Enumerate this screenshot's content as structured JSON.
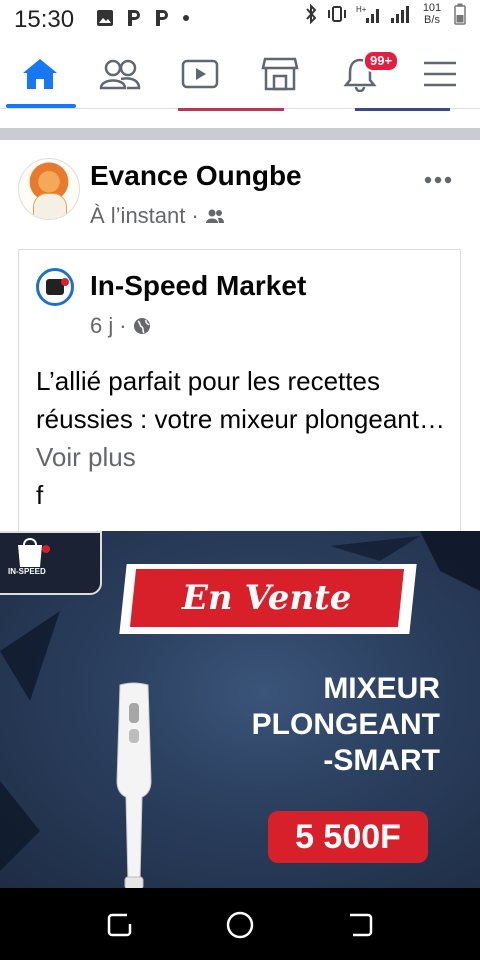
{
  "status_bar": {
    "time": "15:30",
    "net_speed_value": "101",
    "net_speed_unit": "B/s",
    "icons": [
      "gallery-icon",
      "p-icon",
      "p-icon",
      "dot-icon",
      "bluetooth-icon",
      "vibrate-icon",
      "signal-h-plus-icon",
      "signal-icon",
      "signal-icon",
      "battery-icon"
    ]
  },
  "nav": {
    "tabs": [
      "home-icon",
      "friends-icon",
      "watch-icon",
      "marketplace-icon",
      "notifications-icon",
      "menu-icon"
    ],
    "active_tab": "home",
    "notification_badge": "99+",
    "accent": "#1877f2"
  },
  "post": {
    "author": "Evance Oungbe",
    "time": "À l’instant",
    "meta_separator": "·",
    "audience_icon": "friends-icon",
    "shared": {
      "page_name": "In-Speed Market",
      "time": "6 j",
      "meta_separator": "·",
      "audience_icon": "globe-icon",
      "text": "L’allié parfait pour les recettes réussies : votre mixeur plongeant…",
      "see_more": "Voir plus",
      "text_tail": "f"
    }
  },
  "ad_image": {
    "logo_text": "IN-SPEED",
    "ribbon": "En Vente",
    "product_line1": "MIXEUR",
    "product_line2": "PLONGEANT",
    "product_line3": "-SMART",
    "price": "5 500F",
    "accent": "#d8202a"
  },
  "system_nav": [
    "recent-apps-icon",
    "home-circle-icon",
    "back-icon"
  ]
}
